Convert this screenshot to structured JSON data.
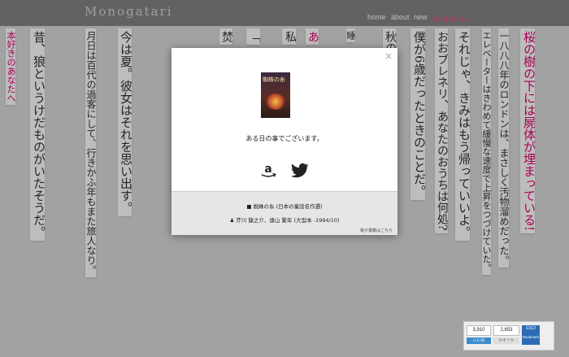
{
  "header": {
    "logo": "Monogatari",
    "nav": [
      {
        "label": "home"
      },
      {
        "label": "about"
      },
      {
        "label": "new"
      },
      {
        "label": "電子書籍を探す"
      }
    ]
  },
  "columns": [
    {
      "text": "桜の樹の下には屍体が埋まっている!",
      "color": "#e0006b"
    },
    {
      "text": "一八八八年のロンドンは、まさしく汚物溜めだった。",
      "color": "#333333"
    },
    {
      "text": "エレベーターはきわめて緩慢な速度で上昇をつづけていた。",
      "color": "#333333"
    },
    {
      "text": "それじゃ、きみはもう帰っていいよ。",
      "color": "#333333"
    },
    {
      "text": "おおブレネリ、あなたのおうちは何処?",
      "color": "#333333"
    },
    {
      "text": "僕が6歳だったときのことだ。",
      "color": "#333333"
    },
    {
      "text": "秋の",
      "color": "#333333"
    },
    {
      "text": "睡",
      "color": "#333333"
    },
    {
      "text": "あ",
      "color": "#e0006b"
    },
    {
      "text": "私",
      "color": "#333333"
    },
    {
      "text": "「",
      "color": "#333333"
    },
    {
      "text": "焚",
      "color": "#333333"
    },
    {
      "text": "今は夏。彼女はそれを思い出す。",
      "color": "#333333"
    },
    {
      "text": "月日は百代の過客にして、行きかふ年もまた旅人なり。",
      "color": "#333333"
    },
    {
      "text": "昔、狼というけだものがいたそうだ。",
      "color": "#333333"
    },
    {
      "text": "本好きのあなたへ",
      "color": "#e0006b"
    }
  ],
  "modal": {
    "close": "×",
    "cover_title": "蜘蛛の糸",
    "caption": "ある日の事でございます。",
    "book_title": "蜘蛛の糸 (日本の童話名作選)",
    "book_author": "芥川 龍之介、遠山 繁年 (大型本 -1994/10)",
    "ebook_link": "電子書籍はこちら"
  },
  "share": {
    "hatena_count": "3,910",
    "hatena_label": "いいね",
    "tweet_count": "2,653",
    "tweet_label": "ツイート",
    "bookmark_count": "1312",
    "bookmark_label": "Bookmark"
  }
}
